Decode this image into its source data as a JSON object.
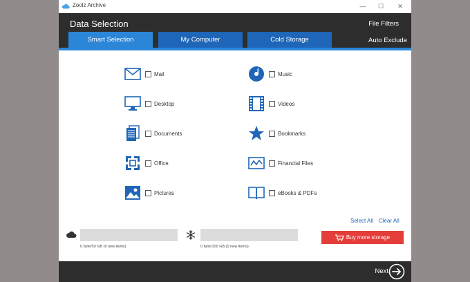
{
  "window": {
    "title": "Zoolz Archive"
  },
  "header": {
    "title": "Data Selection",
    "file_filters": "File Filters",
    "auto_exclude": "Auto Exclude"
  },
  "tabs": [
    {
      "label": "Smart Selection",
      "active": true
    },
    {
      "label": "My Computer",
      "active": false
    },
    {
      "label": "Cold Storage",
      "active": false
    }
  ],
  "categories_left": [
    {
      "label": "Mail",
      "icon": "mail-icon",
      "checked": false
    },
    {
      "label": "Desktop",
      "icon": "desktop-icon",
      "checked": false
    },
    {
      "label": "Documents",
      "icon": "documents-icon",
      "checked": false
    },
    {
      "label": "Office",
      "icon": "office-icon",
      "checked": false
    },
    {
      "label": "Pictures",
      "icon": "pictures-icon",
      "checked": false
    }
  ],
  "categories_right": [
    {
      "label": "Music",
      "icon": "music-icon",
      "checked": false
    },
    {
      "label": "Videos",
      "icon": "videos-icon",
      "checked": false
    },
    {
      "label": "Bookmarks",
      "icon": "bookmarks-icon",
      "checked": false
    },
    {
      "label": "Financial Files",
      "icon": "financial-icon",
      "checked": false
    },
    {
      "label": "eBooks & PDFs",
      "icon": "ebooks-icon",
      "checked": false
    }
  ],
  "actions": {
    "select_all": "Select All",
    "clear_all": "Clear All"
  },
  "storage": {
    "cloud_text": "0 byte/50 GB (0 new items)",
    "cold_text": "0 byte/100 GB (0 new items)",
    "buy_label": "Buy more storage"
  },
  "footer": {
    "next_label": "Next"
  },
  "colors": {
    "accent": "#2b86d8",
    "tab": "#1f66b8",
    "dark": "#2d2d2d",
    "buy": "#e53e3a"
  }
}
